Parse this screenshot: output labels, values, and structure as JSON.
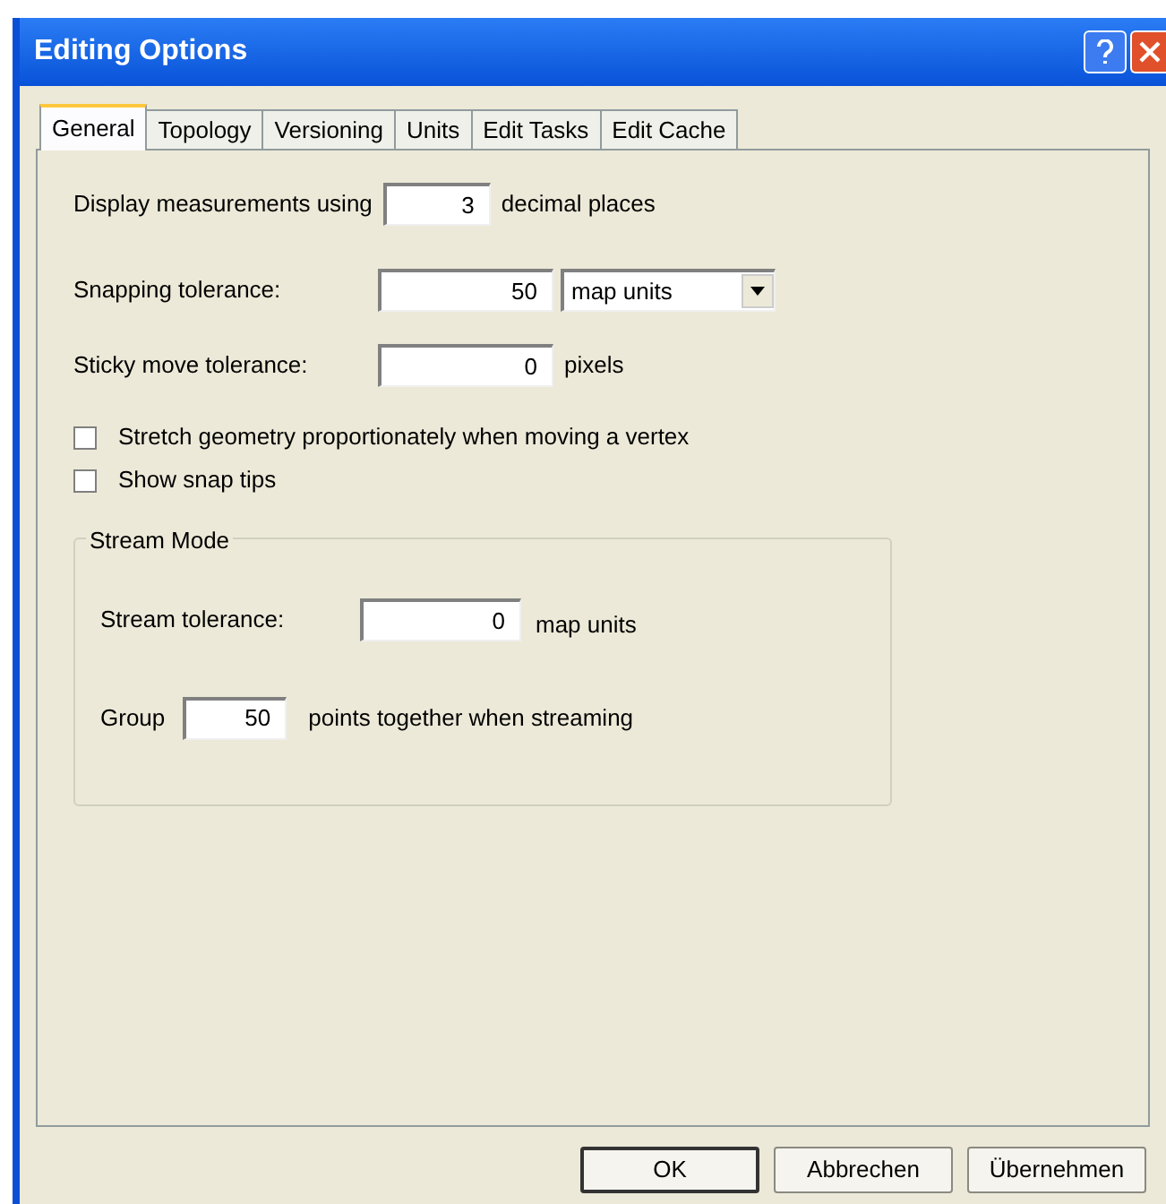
{
  "window": {
    "title": "Editing Options"
  },
  "tabs": [
    {
      "label": "General",
      "selected": true
    },
    {
      "label": "Topology",
      "selected": false
    },
    {
      "label": "Versioning",
      "selected": false
    },
    {
      "label": "Units",
      "selected": false
    },
    {
      "label": "Edit Tasks",
      "selected": false
    },
    {
      "label": "Edit Cache",
      "selected": false
    }
  ],
  "display": {
    "label": "Display measurements using",
    "value": "3",
    "unit": "decimal places"
  },
  "snapping": {
    "label": "Snapping tolerance:",
    "value": "50",
    "unit": "map units"
  },
  "sticky": {
    "label": "Sticky move tolerance:",
    "value": "0",
    "unit": "pixels"
  },
  "checkboxes": [
    {
      "label": "Stretch geometry proportionately when moving a vertex",
      "checked": false
    },
    {
      "label": "Show snap tips",
      "checked": false
    }
  ],
  "stream_mode": {
    "title": "Stream Mode",
    "tolerance": {
      "label": "Stream tolerance:",
      "value": "0",
      "unit": "map units"
    },
    "group": {
      "label": "Group",
      "value": "50",
      "unit": "points together when streaming"
    }
  },
  "buttons": [
    {
      "label": "OK",
      "default": true
    },
    {
      "label": "Abbrechen",
      "default": false
    },
    {
      "label": "Übernehmen",
      "default": false
    }
  ]
}
